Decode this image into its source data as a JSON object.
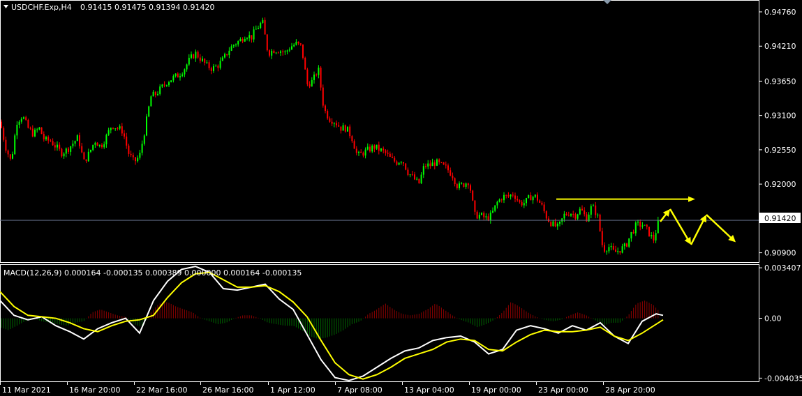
{
  "header": {
    "symbol": "USDCHF.Exp,H4",
    "ohlc": "0.91415 0.91475 0.91394 0.91420"
  },
  "macd_header": "MACD(12,26,9) 0.000164 -0.000135 0.000389 0.000000 0.000164 -0.000135",
  "colors": {
    "background": "#000000",
    "bull": "#00ff00",
    "bear": "#ff0000",
    "axis": "#ffffff",
    "macd_line": "#ffffff",
    "signal_line": "#ffff00",
    "hist_pos": "#8b0000",
    "hist_neg": "#006400",
    "price_line": "#6e7a99",
    "annotation": "#ffff00"
  },
  "chart_data": [
    {
      "type": "candlestick",
      "title": "USDCHF.Exp,H4",
      "ylim": [
        0.9075,
        0.9495
      ],
      "y_ticks": [
        "0.94760",
        "0.94210",
        "0.93650",
        "0.93100",
        "0.92550",
        "0.92000",
        "0.90900"
      ],
      "current_price": "0.91420",
      "x_ticks": [
        "11 Mar 2021",
        "16 Mar 20:00",
        "22 Mar 16:00",
        "26 Mar 16:00",
        "1 Apr 12:00",
        "7 Apr 08:00",
        "13 Apr 04:00",
        "19 Apr 00:00",
        "23 Apr 00:00",
        "28 Apr 20:00"
      ],
      "close_path": [
        [
          0,
          0.93
        ],
        [
          8,
          0.926
        ],
        [
          16,
          0.9235
        ],
        [
          24,
          0.93
        ],
        [
          32,
          0.931
        ],
        [
          40,
          0.929
        ],
        [
          48,
          0.928
        ],
        [
          56,
          0.929
        ],
        [
          64,
          0.927
        ],
        [
          72,
          0.927
        ],
        [
          80,
          0.926
        ],
        [
          88,
          0.925
        ],
        [
          96,
          0.9255
        ],
        [
          104,
          0.9265
        ],
        [
          112,
          0.9275
        ],
        [
          120,
          0.9235
        ],
        [
          128,
          0.925
        ],
        [
          136,
          0.927
        ],
        [
          144,
          0.926
        ],
        [
          152,
          0.9275
        ],
        [
          160,
          0.9295
        ],
        [
          168,
          0.929
        ],
        [
          176,
          0.9285
        ],
        [
          184,
          0.925
        ],
        [
          192,
          0.9235
        ],
        [
          200,
          0.9245
        ],
        [
          208,
          0.929
        ],
        [
          216,
          0.934
        ],
        [
          224,
          0.9345
        ],
        [
          232,
          0.9355
        ],
        [
          240,
          0.9365
        ],
        [
          248,
          0.937
        ],
        [
          256,
          0.9375
        ],
        [
          264,
          0.9385
        ],
        [
          272,
          0.94
        ],
        [
          280,
          0.941
        ],
        [
          288,
          0.94
        ],
        [
          296,
          0.939
        ],
        [
          304,
          0.9385
        ],
        [
          312,
          0.939
        ],
        [
          320,
          0.94
        ],
        [
          328,
          0.9415
        ],
        [
          336,
          0.9425
        ],
        [
          344,
          0.943
        ],
        [
          352,
          0.944
        ],
        [
          360,
          0.9435
        ],
        [
          368,
          0.945
        ],
        [
          376,
          0.946
        ],
        [
          384,
          0.941
        ],
        [
          392,
          0.9415
        ],
        [
          400,
          0.9415
        ],
        [
          408,
          0.941
        ],
        [
          416,
          0.942
        ],
        [
          424,
          0.9425
        ],
        [
          432,
          0.942
        ],
        [
          440,
          0.936
        ],
        [
          448,
          0.9365
        ],
        [
          456,
          0.9385
        ],
        [
          464,
          0.932
        ],
        [
          472,
          0.9305
        ],
        [
          480,
          0.93
        ],
        [
          488,
          0.929
        ],
        [
          496,
          0.929
        ],
        [
          504,
          0.9275
        ],
        [
          512,
          0.9245
        ],
        [
          520,
          0.925
        ],
        [
          528,
          0.9255
        ],
        [
          536,
          0.926
        ],
        [
          544,
          0.9255
        ],
        [
          552,
          0.925
        ],
        [
          560,
          0.924
        ],
        [
          568,
          0.9235
        ],
        [
          576,
          0.924
        ],
        [
          584,
          0.922
        ],
        [
          592,
          0.921
        ],
        [
          600,
          0.92
        ],
        [
          608,
          0.923
        ],
        [
          616,
          0.923
        ],
        [
          624,
          0.9235
        ],
        [
          632,
          0.923
        ],
        [
          640,
          0.9225
        ],
        [
          648,
          0.9215
        ],
        [
          656,
          0.9195
        ],
        [
          664,
          0.92
        ],
        [
          672,
          0.9205
        ],
        [
          680,
          0.915
        ],
        [
          688,
          0.915
        ],
        [
          696,
          0.9145
        ],
        [
          704,
          0.915
        ],
        [
          712,
          0.917
        ],
        [
          720,
          0.918
        ],
        [
          728,
          0.918
        ],
        [
          736,
          0.9185
        ],
        [
          744,
          0.917
        ],
        [
          752,
          0.917
        ],
        [
          760,
          0.918
        ],
        [
          768,
          0.918
        ],
        [
          776,
          0.9165
        ],
        [
          784,
          0.9145
        ],
        [
          792,
          0.9135
        ],
        [
          800,
          0.913
        ],
        [
          808,
          0.915
        ],
        [
          816,
          0.9155
        ],
        [
          824,
          0.915
        ],
        [
          832,
          0.916
        ],
        [
          840,
          0.9145
        ],
        [
          848,
          0.9165
        ],
        [
          856,
          0.915
        ],
        [
          864,
          0.9095
        ],
        [
          872,
          0.91
        ],
        [
          880,
          0.909
        ],
        [
          888,
          0.9095
        ],
        [
          896,
          0.91
        ],
        [
          904,
          0.912
        ],
        [
          912,
          0.9135
        ],
        [
          920,
          0.9135
        ],
        [
          928,
          0.9125
        ],
        [
          936,
          0.911
        ],
        [
          944,
          0.9142
        ]
      ],
      "annotations": [
        {
          "type": "horizontal-arrow",
          "price": 0.9176,
          "x_from": 797,
          "x_to": 996
        },
        {
          "type": "zigzag-arrows",
          "points": [
            [
              946,
              0.914
            ],
            [
              960,
              0.916
            ],
            [
              990,
              0.9103
            ],
            [
              1012,
              0.9151
            ],
            [
              1054,
              0.9107
            ]
          ]
        }
      ]
    },
    {
      "type": "line",
      "title": "MACD(12,26,9)",
      "ylim": [
        -0.0043,
        0.0036
      ],
      "y_ticks": [
        "0.003407",
        "0.00",
        "-0.004035"
      ],
      "series": [
        {
          "name": "MACD",
          "color": "#ffffff",
          "points": [
            [
              0,
              0.0012
            ],
            [
              20,
              0.0002
            ],
            [
              40,
              -0.0001
            ],
            [
              60,
              0.0001
            ],
            [
              80,
              -0.0005
            ],
            [
              100,
              -0.0009
            ],
            [
              120,
              -0.0014
            ],
            [
              140,
              -0.0007
            ],
            [
              160,
              -0.0003
            ],
            [
              180,
              0.0
            ],
            [
              200,
              -0.001
            ],
            [
              220,
              0.0012
            ],
            [
              240,
              0.0025
            ],
            [
              260,
              0.0033
            ],
            [
              280,
              0.0035
            ],
            [
              300,
              0.0031
            ],
            [
              320,
              0.002
            ],
            [
              340,
              0.0019
            ],
            [
              360,
              0.0021
            ],
            [
              380,
              0.0023
            ],
            [
              400,
              0.0013
            ],
            [
              420,
              0.0006
            ],
            [
              440,
              -0.0011
            ],
            [
              460,
              -0.0028
            ],
            [
              480,
              -0.004
            ],
            [
              500,
              -0.0042
            ],
            [
              520,
              -0.0039
            ],
            [
              540,
              -0.0033
            ],
            [
              560,
              -0.0027
            ],
            [
              580,
              -0.0022
            ],
            [
              600,
              -0.002
            ],
            [
              620,
              -0.0015
            ],
            [
              640,
              -0.0013
            ],
            [
              660,
              -0.0012
            ],
            [
              680,
              -0.0016
            ],
            [
              700,
              -0.0024
            ],
            [
              720,
              -0.0021
            ],
            [
              740,
              -0.0008
            ],
            [
              760,
              -0.0005
            ],
            [
              780,
              -0.0007
            ],
            [
              800,
              -0.001
            ],
            [
              820,
              -0.0005
            ],
            [
              840,
              -0.0008
            ],
            [
              860,
              -0.0003
            ],
            [
              880,
              -0.0012
            ],
            [
              900,
              -0.0017
            ],
            [
              920,
              -0.0002
            ],
            [
              940,
              0.0003
            ],
            [
              950,
              0.0002
            ]
          ]
        },
        {
          "name": "Signal",
          "color": "#ffff00",
          "points": [
            [
              0,
              0.0018
            ],
            [
              20,
              0.0008
            ],
            [
              40,
              0.0002
            ],
            [
              60,
              0.0001
            ],
            [
              80,
              0.0
            ],
            [
              100,
              -0.0003
            ],
            [
              120,
              -0.0007
            ],
            [
              140,
              -0.0009
            ],
            [
              160,
              -0.0005
            ],
            [
              180,
              -0.0002
            ],
            [
              200,
              -0.0001
            ],
            [
              220,
              0.0002
            ],
            [
              240,
              0.0014
            ],
            [
              260,
              0.0024
            ],
            [
              280,
              0.003
            ],
            [
              300,
              0.0031
            ],
            [
              320,
              0.0026
            ],
            [
              340,
              0.0021
            ],
            [
              360,
              0.0021
            ],
            [
              380,
              0.0022
            ],
            [
              400,
              0.0018
            ],
            [
              420,
              0.0011
            ],
            [
              440,
              0.0001
            ],
            [
              460,
              -0.0015
            ],
            [
              480,
              -0.003
            ],
            [
              500,
              -0.0038
            ],
            [
              520,
              -0.0041
            ],
            [
              540,
              -0.0038
            ],
            [
              560,
              -0.0033
            ],
            [
              580,
              -0.0027
            ],
            [
              600,
              -0.0024
            ],
            [
              620,
              -0.0021
            ],
            [
              640,
              -0.0016
            ],
            [
              660,
              -0.0014
            ],
            [
              680,
              -0.0015
            ],
            [
              700,
              -0.0021
            ],
            [
              720,
              -0.0022
            ],
            [
              740,
              -0.0016
            ],
            [
              760,
              -0.0011
            ],
            [
              780,
              -0.0008
            ],
            [
              800,
              -0.0009
            ],
            [
              820,
              -0.0009
            ],
            [
              840,
              -0.0008
            ],
            [
              860,
              -0.0006
            ],
            [
              880,
              -0.0012
            ],
            [
              900,
              -0.0015
            ],
            [
              920,
              -0.001
            ],
            [
              940,
              -0.0004
            ],
            [
              950,
              -0.0001
            ]
          ]
        }
      ],
      "histogram": [
        [
          0,
          -0.0006
        ],
        [
          12,
          -0.0008
        ],
        [
          24,
          -0.0005
        ],
        [
          36,
          -0.0002
        ],
        [
          48,
          0.0
        ],
        [
          60,
          -0.0002
        ],
        [
          72,
          -0.0003
        ],
        [
          84,
          -0.0004
        ],
        [
          96,
          -0.0005
        ],
        [
          108,
          -0.0003
        ],
        [
          120,
          -0.0002
        ],
        [
          132,
          0.0004
        ],
        [
          144,
          0.0006
        ],
        [
          156,
          0.0004
        ],
        [
          168,
          0.0002
        ],
        [
          180,
          0.0001
        ],
        [
          192,
          -0.0004
        ],
        [
          204,
          -0.0006
        ],
        [
          216,
          0.0004
        ],
        [
          228,
          0.001
        ],
        [
          240,
          0.0011
        ],
        [
          252,
          0.0008
        ],
        [
          264,
          0.0006
        ],
        [
          276,
          0.0004
        ],
        [
          288,
          0.0
        ],
        [
          300,
          -0.0002
        ],
        [
          312,
          -0.0004
        ],
        [
          324,
          -0.0003
        ],
        [
          336,
          0.0
        ],
        [
          348,
          0.0002
        ],
        [
          360,
          0.0002
        ],
        [
          372,
          0.0
        ],
        [
          384,
          -0.0003
        ],
        [
          396,
          -0.0004
        ],
        [
          408,
          -0.0005
        ],
        [
          420,
          -0.0005
        ],
        [
          432,
          -0.0008
        ],
        [
          444,
          -0.0012
        ],
        [
          456,
          -0.0014
        ],
        [
          468,
          -0.0013
        ],
        [
          480,
          -0.0011
        ],
        [
          492,
          -0.0008
        ],
        [
          504,
          -0.0004
        ],
        [
          516,
          -0.0002
        ],
        [
          528,
          0.0003
        ],
        [
          540,
          0.0006
        ],
        [
          552,
          0.001
        ],
        [
          564,
          0.0006
        ],
        [
          576,
          0.0003
        ],
        [
          588,
          0.0002
        ],
        [
          600,
          0.0003
        ],
        [
          612,
          0.0006
        ],
        [
          624,
          0.001
        ],
        [
          636,
          0.0006
        ],
        [
          648,
          0.0002
        ],
        [
          660,
          -0.0001
        ],
        [
          672,
          -0.0003
        ],
        [
          684,
          -0.0006
        ],
        [
          696,
          -0.0004
        ],
        [
          708,
          -0.0001
        ],
        [
          720,
          0.0004
        ],
        [
          732,
          0.0011
        ],
        [
          744,
          0.0008
        ],
        [
          756,
          0.0004
        ],
        [
          768,
          0.0001
        ],
        [
          780,
          -0.0001
        ],
        [
          792,
          -0.0002
        ],
        [
          804,
          -0.0001
        ],
        [
          816,
          0.0002
        ],
        [
          828,
          0.0004
        ],
        [
          840,
          0.0002
        ],
        [
          852,
          -0.0001
        ],
        [
          864,
          -0.0005
        ],
        [
          876,
          -0.0003
        ],
        [
          888,
          -0.0003
        ],
        [
          900,
          0.0002
        ],
        [
          912,
          0.001
        ],
        [
          924,
          0.0012
        ],
        [
          936,
          0.0009
        ],
        [
          946,
          0.0004
        ]
      ]
    }
  ]
}
